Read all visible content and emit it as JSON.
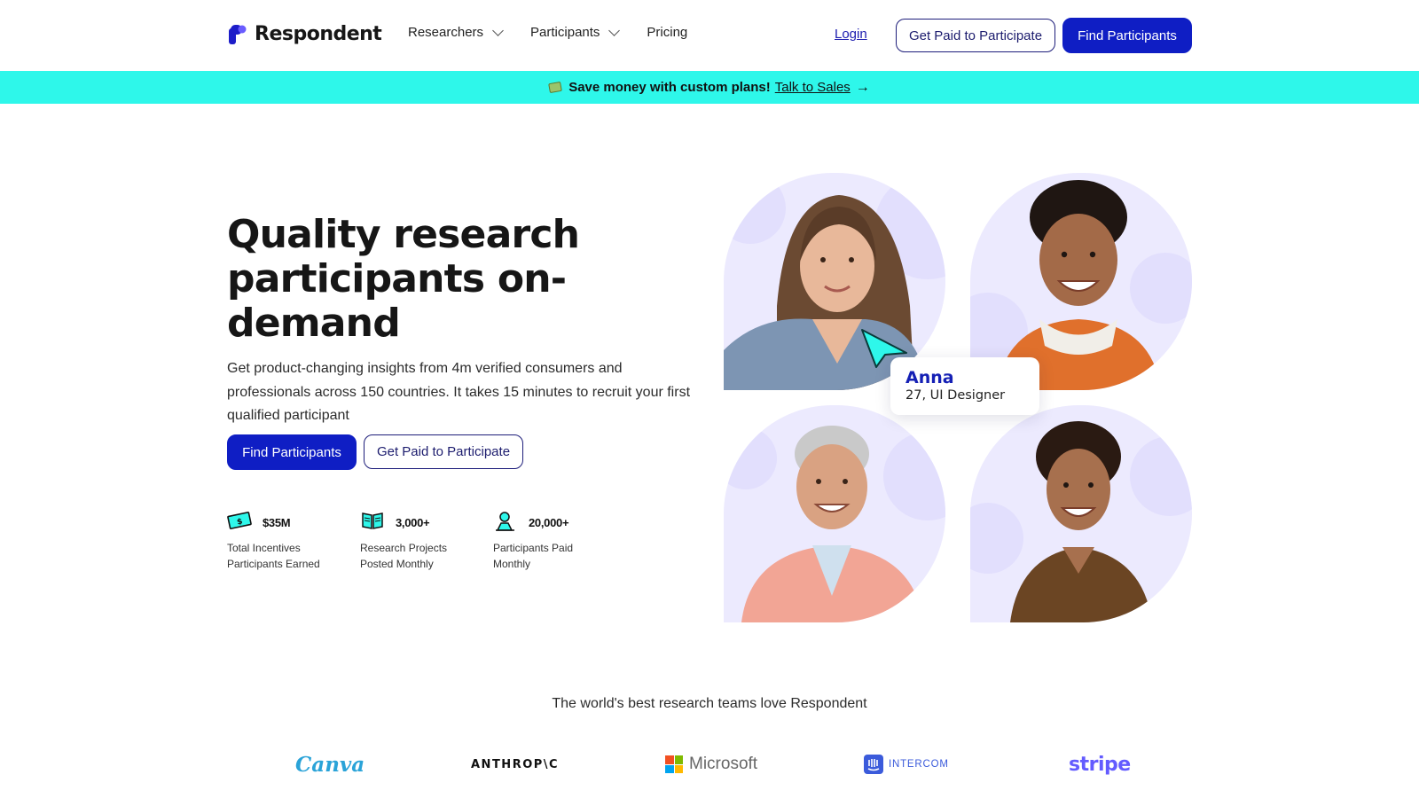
{
  "brand": {
    "name": "Respondent"
  },
  "nav": {
    "items": [
      {
        "label": "Researchers",
        "has_dropdown": true
      },
      {
        "label": "Participants",
        "has_dropdown": true
      },
      {
        "label": "Pricing",
        "has_dropdown": false
      }
    ],
    "login_label": "Login",
    "paid_button": "Get Paid to Participate",
    "find_button": "Find Participants"
  },
  "banner": {
    "icon": "money-icon",
    "promo": "Save money with custom plans!",
    "link": "Talk to Sales",
    "arrow": "→",
    "color": "#2ef7ea"
  },
  "hero": {
    "title": "Quality research participants on-demand",
    "subtitle": "Get product-changing insights from 4m verified consumers and professionals across 150 countries. It takes 15 minutes to recruit your first qualified participant",
    "find_button": "Find Participants",
    "paid_button": "Get Paid to Participate",
    "stats": [
      {
        "icon": "money-bill-icon",
        "value": "$35M",
        "label": "Total Incentives\nParticipants Earned"
      },
      {
        "icon": "book-icon",
        "value": "3,000+",
        "label": "Research Projects\nPosted Monthly"
      },
      {
        "icon": "person-pin-icon",
        "value": "20,000+",
        "label": "Participants Paid\nMonthly"
      }
    ]
  },
  "profile_card": {
    "name": "Anna",
    "detail": "27, UI Designer"
  },
  "trusted": {
    "heading": "The world's best research teams love Respondent",
    "logos": [
      "Canva",
      "ANTHROP\\C",
      "Microsoft",
      "INTERCOM",
      "stripe"
    ]
  },
  "colors": {
    "primary": "#0f1ec4",
    "accent": "#2ef7ea",
    "photo_bg": "#eceafe"
  }
}
